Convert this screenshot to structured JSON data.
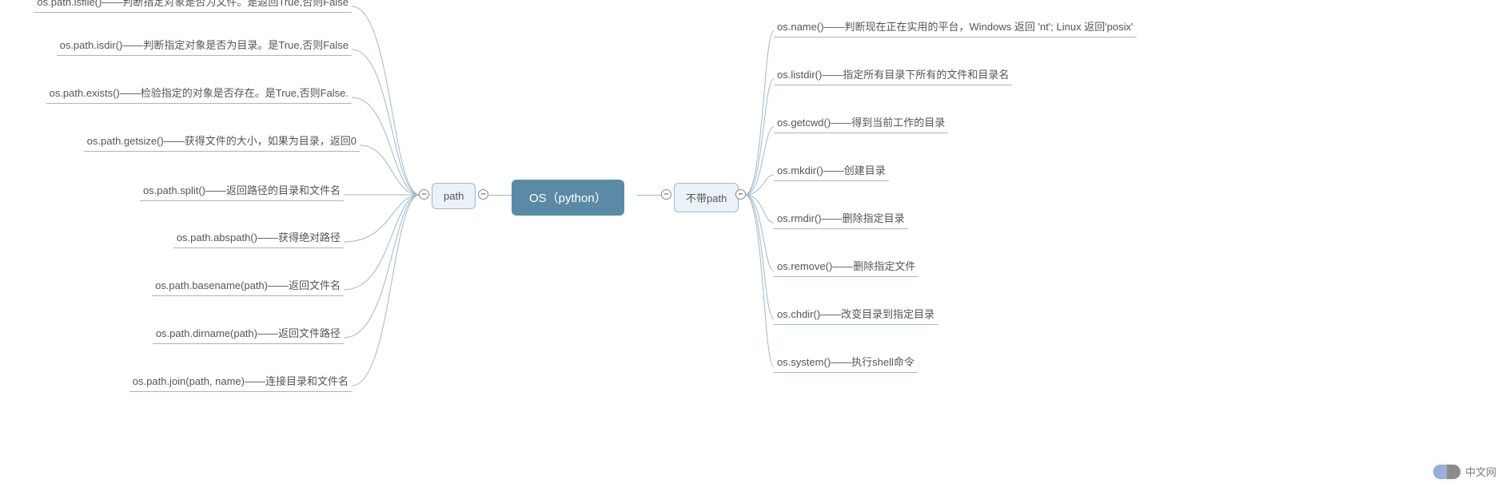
{
  "root": {
    "label": "OS（python）"
  },
  "left_branch": {
    "label": "path",
    "items": [
      "os.path.isfile()——判断指定对象是否为文件。是返回True,否则False",
      "os.path.isdir()——判断指定对象是否为目录。是True,否则False",
      "os.path.exists()——检验指定的对象是否存在。是True,否则False.",
      "os.path.getsize()——获得文件的大小，如果为目录，返回0",
      "os.path.split()——返回路径的目录和文件名",
      "os.path.abspath()——获得绝对路径",
      "os.path.basename(path)——返回文件名",
      "os.path.dirname(path)——返回文件路径",
      "os.path.join(path, name)——连接目录和文件名"
    ]
  },
  "right_branch": {
    "label": "不带path",
    "items": [
      "os.name()——判断现在正在实用的平台，Windows 返回 'nt'; Linux 返回'posix'",
      "os.listdir()——指定所有目录下所有的文件和目录名",
      "os.getcwd()——得到当前工作的目录",
      "os.mkdir()——创建目录",
      "os.rmdir()——删除指定目录",
      "os.remove()——删除指定文件",
      "os.chdir()——改变目录到指定目录",
      "os.system()——执行shell命令"
    ]
  },
  "watermark": {
    "text": "中文网"
  },
  "toggle_glyph": "–",
  "colors": {
    "stroke": "#a0b8c8",
    "root_bg": "#5b8aa6",
    "node_bg": "#eaf2f8"
  }
}
